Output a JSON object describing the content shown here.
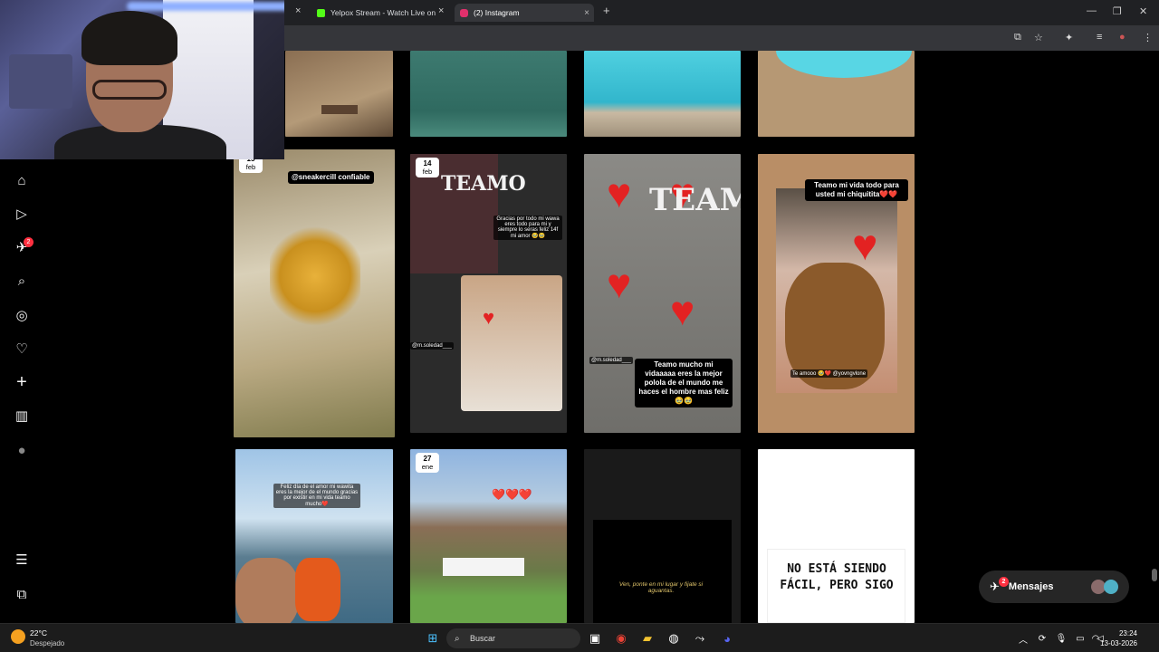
{
  "browser": {
    "tabs": [
      {
        "label": "Yelpox Stream - Watch Live on",
        "icon_color": "#53fc18",
        "active": false
      },
      {
        "label": "(2) Instagram",
        "icon_color": "#e1306c",
        "active": true
      }
    ],
    "new_tab_symbol": "+",
    "close_symbol": "×"
  },
  "sidebar": {
    "items": [
      {
        "name": "home-icon",
        "glyph": "⌂"
      },
      {
        "name": "reels-icon",
        "glyph": "▷"
      },
      {
        "name": "messages-icon",
        "glyph": "✈"
      },
      {
        "name": "search-icon",
        "glyph": "⌕"
      },
      {
        "name": "explore-icon",
        "glyph": "◎"
      },
      {
        "name": "notifications-icon",
        "glyph": "♡"
      },
      {
        "name": "create-icon",
        "glyph": "+"
      },
      {
        "name": "dashboard-icon",
        "glyph": "▥"
      },
      {
        "name": "profile-avatar-icon",
        "glyph": "●"
      },
      {
        "name": "more-menu-icon",
        "glyph": "☰"
      },
      {
        "name": "also-from-meta-icon",
        "glyph": "⧉"
      }
    ],
    "messages_badge": "2"
  },
  "grid": {
    "row2": [
      {
        "date_day": "15",
        "date_month": "feb",
        "caption": "@sneakercill confiable"
      },
      {
        "date_day": "14",
        "date_month": "feb",
        "caption": "Gracias por todo mi wawa eres todo para mi y siempre lo seras feliz 14f mi amor 🥹🥹",
        "mention": "@m.soledad___",
        "teamo": "TEAMO"
      },
      {
        "caption": "Teamo mucho mi vidaaaaa eres la mejor polola de el mundo me haces el hombre mas feliz🥹🥹",
        "mention": "@m.soledad___",
        "teamo": "TEAMO"
      },
      {
        "caption": "Teamo mi vida todo para usted mi chiquitita❤️❤️",
        "sticker": "Te amooo 🥹❤️ @yovngvlone"
      }
    ],
    "row3": [
      {
        "caption": "Feliz día de el amor mi wawita eres la mejor de el mundo gracias por existir en mi vida teamo mucho❤️"
      },
      {
        "date_day": "27",
        "date_month": "ene",
        "caption": "❤️❤️❤️"
      },
      {
        "caption": "Ven, ponte en mi lugar y fijate si aguantas."
      },
      {
        "caption": "NO ESTÁ SIENDO FÁCIL, PERO SIGO"
      }
    ]
  },
  "messages_button": {
    "label": "Mensajes",
    "badge": "2"
  },
  "taskbar": {
    "temperature": "22°C",
    "weather": "Despejado",
    "search_placeholder": "Buscar",
    "time": "23:24",
    "date": "13-03-2026"
  }
}
